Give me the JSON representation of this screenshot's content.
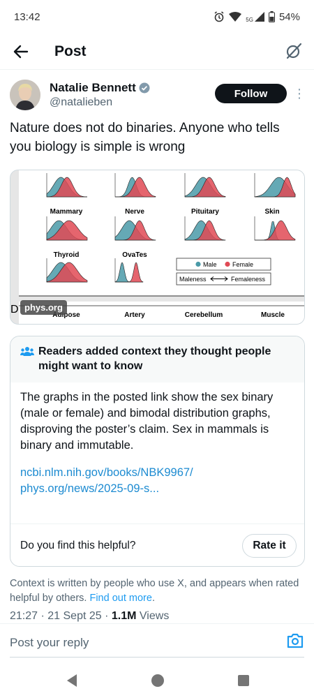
{
  "status_bar": {
    "time": "13:42",
    "network": "5G",
    "battery": "54%"
  },
  "header": {
    "title": "Post"
  },
  "author": {
    "name": "Natalie Bennett",
    "handle": "@natalieben",
    "follow_label": "Follow"
  },
  "post": {
    "text": "Nature does not do binaries. Anyone who tells you biology is simple is wrong"
  },
  "media": {
    "source_badge": "phys.org",
    "panel_labels": [
      "Mammary",
      "Nerve",
      "Pituitary",
      "Skin",
      "Thyroid",
      "OvaTes"
    ],
    "bottom_labels": [
      "Adipose",
      "Artery",
      "Cerebellum",
      "Muscle"
    ],
    "panel_d_letter": "D",
    "legend": {
      "male": "Male",
      "female": "Female",
      "maleness": "Maleness",
      "femaleness": "Femaleness"
    },
    "colors": {
      "male": "#4a9aa8",
      "female": "#e04a55"
    }
  },
  "note": {
    "header": "Readers added context they thought people might want to know",
    "body": "The graphs in the posted link show the sex binary (male or female) and bimodal distribution graphs, disproving the poster’s claim. Sex in mammals is binary and immutable.",
    "links": [
      "ncbi.nlm.nih.gov/books/NBK9967/",
      "phys.org/news/2025-09-s..."
    ],
    "helpful_question": "Do you find this helpful?",
    "rate_label": "Rate it"
  },
  "context": {
    "text": "Context is written by people who use X, and appears when rated helpful by others.",
    "link": "Find out more",
    "suffix": "."
  },
  "meta": {
    "time": "21:27",
    "date": "21 Sept 25",
    "views_count": "1.1M",
    "views_label": "Views"
  },
  "reply": {
    "placeholder": "Post your reply"
  }
}
